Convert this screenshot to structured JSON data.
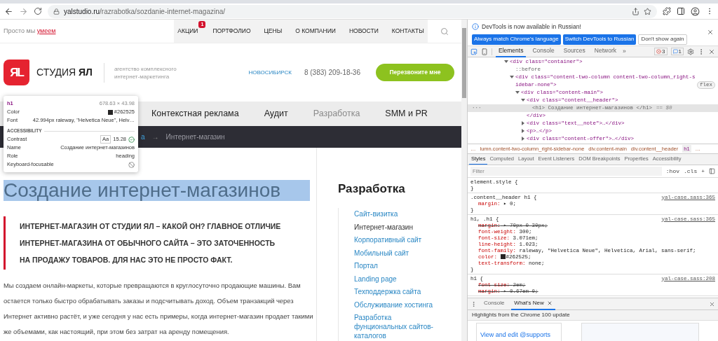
{
  "browser": {
    "url_domain": "yalstudio.ru",
    "url_path": "/razrabotka/sozdanie-internet-magazina/"
  },
  "site": {
    "tagline": "Просто мы",
    "tagline_link": "умеем",
    "menu": [
      {
        "label": "АКЦИИ",
        "badge": "1"
      },
      {
        "label": "ПОРТФОЛИО"
      },
      {
        "label": "ЦЕНЫ"
      },
      {
        "label": "О КОМПАНИИ"
      },
      {
        "label": "НОВОСТИ"
      },
      {
        "label": "КОНТАКТЫ"
      }
    ],
    "logo_mark": "ЯL",
    "brand": "СТУДИЯ **ЯЛ**",
    "slogan": [
      "агентство комплексного",
      "интернет-маркетинга"
    ],
    "city": "НОВОСИБИРСК",
    "phone": "8 (383) 209-18-36",
    "callback_button": "Перезвоните мне",
    "services": [
      {
        "label": "Контекстная реклама",
        "selected": false
      },
      {
        "label": "Аудит",
        "selected": false
      },
      {
        "label": "Разработка",
        "selected": true
      },
      {
        "label": "SMM и PR",
        "selected": false
      }
    ],
    "breadcrumbs": [
      {
        "label": "а",
        "kind": "link"
      },
      {
        "label": "→",
        "kind": "separator"
      },
      {
        "label": "Интернет-магазин",
        "kind": "current"
      }
    ],
    "heading": "Создание интернет-магазинов",
    "heading_highlighted": true,
    "lead": [
      "ИНТЕРНЕТ-МАГАЗИН ОТ СТУДИИ ЯЛ – КАКОЙ ОН? ГЛАВНОЕ ОТЛИЧИЕ",
      "ИНТЕРНЕТ-МАГАЗИНА ОТ ОБЫЧНОГО САЙТА – ЭТО ЗАТОЧЕННОСТЬ",
      "НА ПРОДАЖУ ТОВАРОВ. ДЛЯ НАС ЭТО НЕ ПРОСТО ФАКТ."
    ],
    "body": "Мы создаем онлайн-маркеты, которые превращаются в круглосуточно продающие машины. Вам остается только быстро обрабатывать заказы и подсчитывать доход. Объем транзакций через Интернет активно растёт, и уже сегодня у нас есть примеры, когда интернет-магазин продает такими же объемами, как настоящий, при этом без затрат на аренду помещения.",
    "sidebar": {
      "title": "Разработка",
      "items": [
        {
          "label": "Сайт-визитка",
          "selected": false
        },
        {
          "label": "Интернет-магазин",
          "selected": true
        },
        {
          "label": "Корпоративный сайт",
          "selected": false
        },
        {
          "label": "Мобильный сайт",
          "selected": false
        },
        {
          "label": "Портал",
          "selected": false
        },
        {
          "label": "Landing page",
          "selected": false
        },
        {
          "label": "Техподдержка сайта",
          "selected": false
        },
        {
          "label": "Обслуживание хостинга",
          "selected": false
        },
        {
          "label": "Разработка фунциональных сайтов-каталогов",
          "selected": false
        }
      ]
    }
  },
  "inspect_tooltip": {
    "tag": "h1",
    "size": "678.63 × 43.98",
    "rows": [
      {
        "label": "Color",
        "kind": "color",
        "value": "#262525"
      },
      {
        "label": "Font",
        "kind": "text",
        "value": "42.994px raleway, \"Helvetica Neue\", Helv…"
      }
    ],
    "section": "ACCESSIBILITY",
    "a11y": [
      {
        "label": "Contrast",
        "kind": "contrast",
        "badge": "Aa",
        "value": "15.28"
      },
      {
        "label": "Name",
        "kind": "text",
        "value": "Создание интернет-магазинов"
      },
      {
        "label": "Role",
        "kind": "text",
        "value": "heading"
      },
      {
        "label": "Keyboard-focusable",
        "kind": "blocked"
      }
    ]
  },
  "devtools": {
    "infobar": {
      "message": "DevTools is now available in Russian!",
      "buttons": [
        {
          "label": "Always match Chrome's language",
          "kind": "primary"
        },
        {
          "label": "Switch DevTools to Russian",
          "kind": "primary"
        },
        {
          "label": "Don't show again",
          "kind": "secondary"
        }
      ]
    },
    "tabs": [
      {
        "label": "Elements",
        "selected": true
      },
      {
        "label": "Console",
        "selected": false
      },
      {
        "label": "Sources",
        "selected": false
      },
      {
        "label": "Network",
        "selected": false
      }
    ],
    "more": "»",
    "errors": "3",
    "messages": "1",
    "selected_marker": "···",
    "dom": [
      {
        "open": "<div class=\"container\">",
        "expanded": true,
        "selected": false,
        "children": [
          {
            "open": "::before",
            "selected": false
          },
          {
            "open": "<div class=\"content-two-column  content-two-column_right-sidebar-none\">",
            "badge": "flex",
            "expanded": true,
            "selected": false,
            "children": [
              {
                "open": "<div class=\"content-main\">",
                "expanded": true,
                "selected": false,
                "children": [
                  {
                    "open": "<div class=\"content__header\">",
                    "expanded": true,
                    "selected": false,
                    "close": "</div>",
                    "children": [
                      {
                        "open": "<h1> Создание интернет-магазинов </h1>",
                        "suffix": "== $0",
                        "selected": true
                      }
                    ]
                  },
                  {
                    "open": "<div class=\"text__note\">…</div>",
                    "expanded": false,
                    "selected": false
                  },
                  {
                    "open": "<p>…</p>",
                    "expanded": false,
                    "selected": false
                  },
                  {
                    "open": "<div class=\"content-offer\">…</div>",
                    "expanded": false,
                    "selected": false
                  }
                ]
              }
            ]
          }
        ]
      }
    ],
    "crumbs": [
      {
        "label": "…",
        "selected": false
      },
      {
        "label": "lumn.content-two-column_right-sidebar-none",
        "selected": false
      },
      {
        "label": "div.content-main",
        "selected": false
      },
      {
        "label": "div.content__header",
        "selected": false
      },
      {
        "label": "h1",
        "selected": true
      },
      {
        "label": "…",
        "selected": false
      }
    ],
    "panel_tabs": [
      {
        "label": "Styles",
        "selected": true
      },
      {
        "label": "Computed",
        "selected": false
      },
      {
        "label": "Layout",
        "selected": false
      },
      {
        "label": "Event Listeners",
        "selected": false
      },
      {
        "label": "DOM Breakpoints",
        "selected": false
      },
      {
        "label": "Properties",
        "selected": false
      },
      {
        "label": "Accessibility",
        "selected": false
      }
    ],
    "filter_placeholder": "Filter",
    "filter_tools": [
      ":hov",
      ".cls",
      "+"
    ],
    "rules": [
      {
        "selector": "element.style {",
        "close": "}"
      },
      {
        "selector": ".content__header h1 {",
        "source": "yal-case.sass:365",
        "close": "}",
        "decls": [
          {
            "prop": "margin:",
            "value": "▸ 0;",
            "struck": false
          }
        ]
      },
      {
        "selector": "h1, .h1 {",
        "source": "yal-case.sass:365",
        "close": "}",
        "decls": [
          {
            "prop": "margin:",
            "value": "▸ 70px 0 30px;",
            "struck": true
          },
          {
            "prop": "font-weight:",
            "value": "300;",
            "struck": false
          },
          {
            "prop": "font-size:",
            "value": "3.071em;",
            "struck": false
          },
          {
            "prop": "line-height:",
            "value": "1.023;",
            "struck": false
          },
          {
            "prop": "font-family:",
            "value": "raleway, \"Helvetica Neue\", Helvetica, Arial, sans-serif;",
            "struck": false
          },
          {
            "prop": "color:",
            "value": "#262525;",
            "struck": false,
            "color": "#262525"
          },
          {
            "prop": "text-transform:",
            "value": "none;",
            "struck": false
          }
        ]
      },
      {
        "selector": "h1 {",
        "source": "yal-case.sass:208",
        "decls": [
          {
            "prop": "font-size:",
            "value": "2em;",
            "struck": true
          },
          {
            "prop": "margin:",
            "value": "▸ 0.67em 0;",
            "struck": true
          }
        ]
      }
    ],
    "drawer_tabs": [
      {
        "label": "Console",
        "selected": false,
        "closable": false
      },
      {
        "label": "What's New",
        "selected": true,
        "closable": true
      }
    ],
    "whats_new_title": "Highlights from the Chrome 100 update",
    "card_title": "View and edit @supports"
  }
}
